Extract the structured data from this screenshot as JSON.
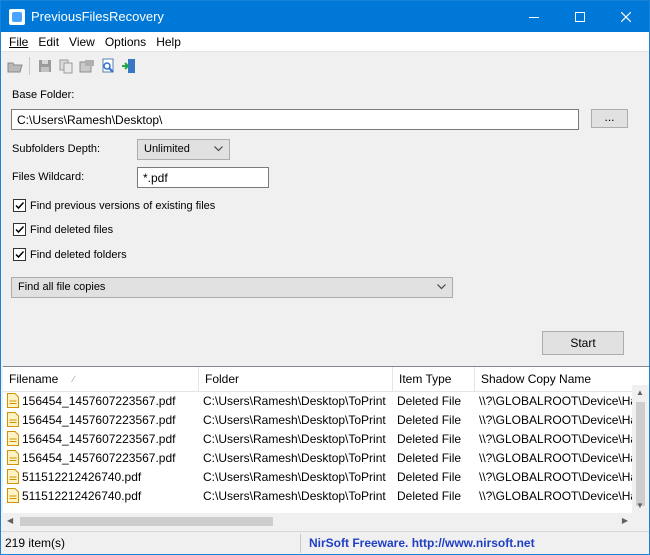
{
  "window": {
    "title": "PreviousFilesRecovery"
  },
  "menu": [
    "File",
    "Edit",
    "View",
    "Options",
    "Help"
  ],
  "toolbar": {
    "icons": [
      "open-icon",
      "save-icon",
      "copy-icon",
      "properties-icon",
      "find-icon",
      "exit-icon"
    ]
  },
  "form": {
    "base_folder_label": "Base Folder:",
    "base_folder_value": "C:\\Users\\Ramesh\\Desktop\\",
    "browse_label": "...",
    "subfolders_depth_label": "Subfolders Depth:",
    "subfolders_depth_value": "Unlimited",
    "files_wildcard_label": "Files Wildcard:",
    "files_wildcard_value": "*.pdf",
    "checks": [
      {
        "label": "Find previous versions of existing files",
        "checked": true
      },
      {
        "label": "Find deleted files",
        "checked": true
      },
      {
        "label": "Find deleted folders",
        "checked": true
      }
    ],
    "copies_mode_value": "Find all file copies",
    "start_label": "Start"
  },
  "table": {
    "columns": [
      "Filename",
      "Folder",
      "Item Type",
      "Shadow Copy Name"
    ],
    "rows": [
      [
        "156454_1457607223567.pdf",
        "C:\\Users\\Ramesh\\Desktop\\ToPrint",
        "Deleted File",
        "\\\\?\\GLOBALROOT\\Device\\Ha"
      ],
      [
        "156454_1457607223567.pdf",
        "C:\\Users\\Ramesh\\Desktop\\ToPrint",
        "Deleted File",
        "\\\\?\\GLOBALROOT\\Device\\Ha"
      ],
      [
        "156454_1457607223567.pdf",
        "C:\\Users\\Ramesh\\Desktop\\ToPrint",
        "Deleted File",
        "\\\\?\\GLOBALROOT\\Device\\Ha"
      ],
      [
        "156454_1457607223567.pdf",
        "C:\\Users\\Ramesh\\Desktop\\ToPrint",
        "Deleted File",
        "\\\\?\\GLOBALROOT\\Device\\Ha"
      ],
      [
        "511512212426740.pdf",
        "C:\\Users\\Ramesh\\Desktop\\ToPrint",
        "Deleted File",
        "\\\\?\\GLOBALROOT\\Device\\Ha"
      ],
      [
        "511512212426740.pdf",
        "C:\\Users\\Ramesh\\Desktop\\ToPrint",
        "Deleted File",
        "\\\\?\\GLOBALROOT\\Device\\Ha"
      ]
    ]
  },
  "status": {
    "count": "219 item(s)",
    "credit": "NirSoft Freeware.  http://www.nirsoft.net"
  },
  "colors": {
    "titlebar": "#0078d7",
    "credit_link": "#1f3fc4",
    "file_icon": "#e8a200"
  }
}
